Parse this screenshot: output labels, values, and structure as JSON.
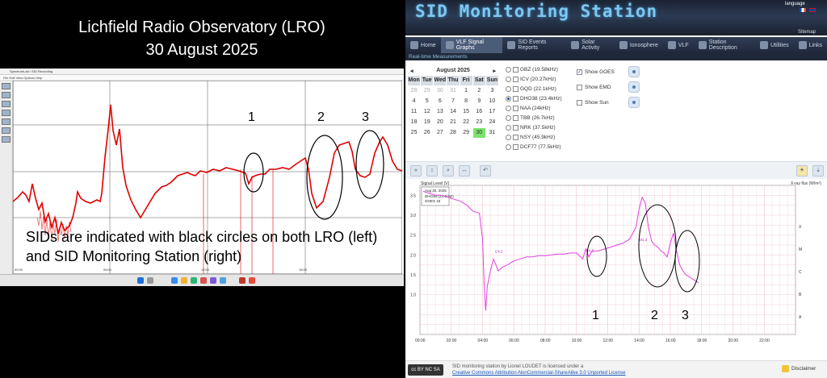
{
  "left": {
    "title_line1": "Lichfield Radio Observatory (LRO)",
    "title_line2": "30 August 2025",
    "caption": "SIDs are indicated with black circles on both LRO (left) and SID Monitoring Station (right)",
    "window_title": "SpectrumLab / SID Recording",
    "menu": "File  Edit  View  Options  Help",
    "circle_labels": [
      "1",
      "2",
      "3"
    ],
    "x_ticks": [
      "00:00",
      "06:00",
      "12:00",
      "18:00"
    ]
  },
  "right": {
    "site_title": "SID Monitoring Station",
    "language_label": "language",
    "sitemap_label": "Sitemap",
    "nav": [
      {
        "label": "Home",
        "icon": "home-icon"
      },
      {
        "label": "VLF Signal Graphs",
        "icon": "graph-icon",
        "active": true
      },
      {
        "label": "SID Events Reports",
        "icon": "report-icon"
      },
      {
        "label": "Solar Activity",
        "icon": "sun-icon"
      },
      {
        "label": "Ionosphere",
        "icon": "ionosphere-icon"
      },
      {
        "label": "VLF",
        "icon": "antenna-icon"
      },
      {
        "label": "Station Description",
        "icon": "station-icon"
      },
      {
        "label": "Utilities",
        "icon": "tools-icon"
      },
      {
        "label": "Links",
        "icon": "link-icon"
      }
    ],
    "subnav": "Real-time Measurements",
    "calendar": {
      "month": "August 2025",
      "dow": [
        "Mon",
        "Tue",
        "Wed",
        "Thu",
        "Fri",
        "Sat",
        "Sun"
      ],
      "days": [
        "28",
        "29",
        "30",
        "31",
        "1",
        "2",
        "3",
        "4",
        "5",
        "6",
        "7",
        "8",
        "9",
        "10",
        "11",
        "12",
        "13",
        "14",
        "15",
        "16",
        "17",
        "18",
        "19",
        "20",
        "21",
        "22",
        "23",
        "24",
        "25",
        "26",
        "27",
        "28",
        "29",
        "30",
        "31"
      ],
      "selected_day": "30"
    },
    "stations": [
      {
        "label": "GBZ (19.58kHz)",
        "selected": false
      },
      {
        "label": "ICV (20.27kHz)",
        "selected": false
      },
      {
        "label": "GQD (22.1kHz)",
        "selected": false
      },
      {
        "label": "DHO38 (23.4kHz)",
        "selected": true
      },
      {
        "label": "NAA (24kHz)",
        "selected": false
      },
      {
        "label": "TBB (26.7kHz)",
        "selected": false
      },
      {
        "label": "NRK (37.5kHz)",
        "selected": false
      },
      {
        "label": "NSY (45.9kHz)",
        "selected": false
      },
      {
        "label": "DCF77 (77.5kHz)",
        "selected": false
      }
    ],
    "options": [
      {
        "label": "Show GOES",
        "checked": true
      },
      {
        "label": "Show EMD",
        "checked": false
      },
      {
        "label": "Show Sun",
        "checked": false
      }
    ],
    "footer_text": "SID monitoring station by Lionel LOUDET is licensed under a",
    "footer_link": "Creative Commons Attribution-NonCommercial-ShareAlike 3.0 Unported License",
    "author": "Lionel LOUDET",
    "cc_badge": "cc BY NC SA",
    "disclaimer": "Disclaimer"
  },
  "chart_data": {
    "type": "line",
    "title": "",
    "ylabel": "Signal Level (V)",
    "y2label": "X-ray flux (W/m²)",
    "legend_date": "Aug 30, 2025",
    "legend_series": "DHO38 (23.4kHz)",
    "legend_goes": "GOES 15",
    "x_ticks": [
      "00:00",
      "02:00",
      "04:00",
      "06:00",
      "08:00",
      "10:00",
      "12:00",
      "14:00",
      "16:00",
      "18:00",
      "20:00",
      "22:00"
    ],
    "y_ticks": [
      "1.0",
      "1.5",
      "2.0",
      "2.5",
      "3.0",
      "3.5"
    ],
    "ylim": [
      0.0,
      3.75
    ],
    "xlim": [
      0,
      24
    ],
    "y2_classes": [
      "A",
      "B",
      "C",
      "M",
      "X"
    ],
    "annotations": [
      {
        "text": "C4.2",
        "x": 4.8,
        "y": 2.06
      },
      {
        "text": "C4.3",
        "x": 10.6,
        "y": 2.08
      },
      {
        "text": "M1.3",
        "x": 14.0,
        "y": 2.35
      }
    ],
    "circle_labels": [
      "1",
      "2",
      "3"
    ],
    "series": [
      {
        "name": "DHO38 (23.4kHz)",
        "color": "#e040e0",
        "x": [
          0.2,
          0.6,
          1.0,
          1.4,
          1.8,
          2.2,
          2.6,
          3.0,
          3.4,
          3.8,
          4.0,
          4.1,
          4.2,
          4.3,
          4.5,
          4.7,
          5.0,
          5.3,
          5.6,
          6.0,
          6.4,
          6.8,
          7.2,
          7.6,
          8.0,
          8.4,
          8.8,
          9.2,
          9.6,
          10.0,
          10.4,
          10.6,
          10.8,
          11.0,
          11.4,
          11.8,
          12.2,
          12.6,
          13.0,
          13.4,
          13.8,
          14.0,
          14.2,
          14.4,
          14.6,
          14.8,
          15.0,
          15.2,
          15.4,
          15.6,
          15.8,
          16.0,
          16.2,
          16.4,
          16.6,
          16.8,
          17.0,
          17.4,
          17.8
        ],
        "values": [
          3.6,
          3.55,
          3.5,
          3.5,
          3.45,
          3.4,
          3.35,
          3.25,
          3.1,
          3.05,
          2.4,
          1.3,
          0.6,
          1.2,
          1.6,
          1.9,
          1.6,
          1.7,
          1.75,
          1.85,
          1.9,
          1.95,
          1.95,
          1.98,
          1.98,
          2.0,
          2.02,
          2.02,
          2.05,
          2.05,
          1.9,
          2.15,
          1.95,
          2.1,
          2.1,
          2.15,
          2.2,
          2.25,
          2.3,
          2.4,
          2.7,
          3.15,
          3.45,
          3.3,
          2.7,
          2.35,
          2.25,
          2.2,
          2.1,
          2.05,
          1.95,
          2.3,
          2.55,
          2.1,
          1.75,
          1.6,
          1.5,
          1.4,
          1.3
        ]
      }
    ]
  },
  "colors": {
    "series": "#e040e0",
    "grid": "#f2c2cc",
    "lro_trace": "#e00000",
    "banner": "#2b3a52",
    "selected_day": "#7be36b"
  }
}
